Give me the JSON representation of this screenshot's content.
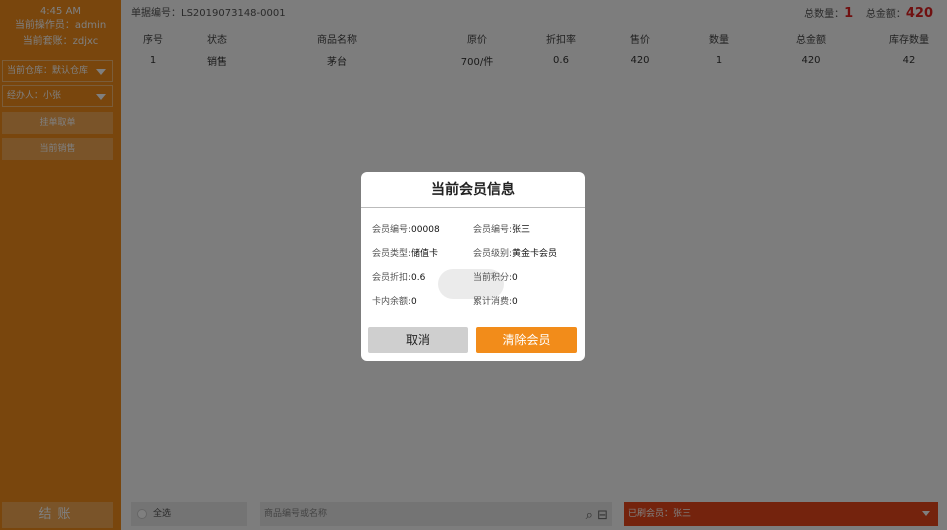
{
  "sidebar": {
    "time": "4:45 AM",
    "operator": "当前操作员：admin",
    "shift": "当前套账：zdjxc",
    "warehouse_select": "当前仓库：默认仓库",
    "handler_select": "经办人：小张",
    "btn_hold": "挂单取单",
    "btn_current_sale": "当前销售",
    "btn_checkout": "结账"
  },
  "topbar": {
    "order_no_label": "单据编号：",
    "order_no": "LS2019073148-0001",
    "total_qty_label": "总数量：",
    "total_qty": "1",
    "total_amount_label": "总金额：",
    "total_amount": "420"
  },
  "table": {
    "headers": [
      "序号",
      "状态",
      "商品名称",
      "原价",
      "折扣率",
      "售价",
      "数量",
      "总金额",
      "库存数量"
    ],
    "rows": [
      [
        "1",
        "销售",
        "茅台",
        "700/件",
        "0.6",
        "420",
        "1",
        "420",
        "42"
      ]
    ]
  },
  "bottombar": {
    "select_all": "全选",
    "search_placeholder": "商品编号或名称",
    "member_label": "已刷会员：张三"
  },
  "modal": {
    "title": "当前会员信息",
    "member_no_label": "会员编号:",
    "member_no": "00008",
    "member_name_label": "会员编号:",
    "member_name": "张三",
    "member_type_label": "会员类型:",
    "member_type": "储值卡",
    "member_level_label": "会员级别:",
    "member_level": "黄金卡会员",
    "discount_label": "会员折扣:",
    "discount": "0.6",
    "points_label": "当前积分:",
    "points": "0",
    "balance_label": "卡内余额:",
    "balance": "0",
    "total_spent_label": "累计消费:",
    "total_spent": "0",
    "cancel_label": "取消",
    "clear_label": "清除会员"
  },
  "colors": {
    "accent_orange": "#f28c1a",
    "member_bar_red": "#e8471a",
    "total_red": "#e02020"
  }
}
